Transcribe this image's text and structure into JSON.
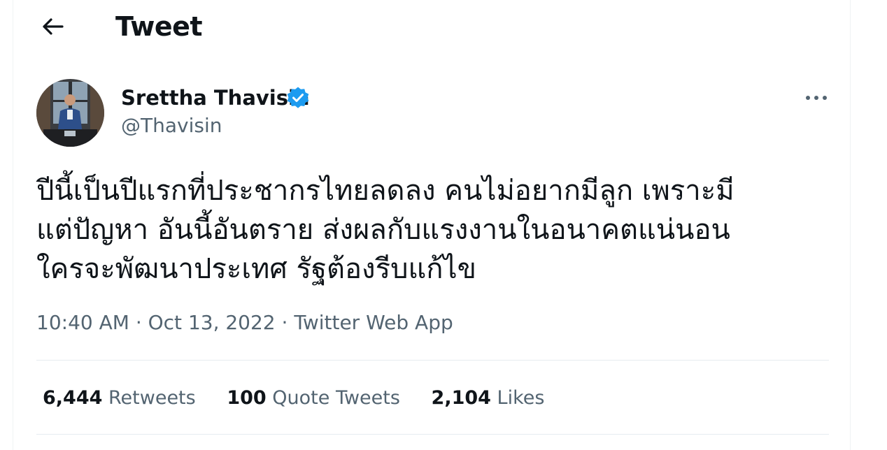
{
  "header": {
    "title": "Tweet"
  },
  "author": {
    "display_name": "Srettha Thavisin",
    "handle": "@Thavisin",
    "verified": true
  },
  "tweet": {
    "text": "ปีนี้เป็นปีแรกที่ประชากรไทยลดลง คนไม่อยากมีลูก เพราะมี\nแต่ปัญหา อันนี้อันตราย ส่งผลกับแรงงานในอนาคตแน่นอน\nใครจะพัฒนาประเทศ รัฐต้องรีบแก้ไข",
    "time": "10:40 AM",
    "separator": "·",
    "date": "Oct 13, 2022",
    "source": "Twitter Web App"
  },
  "stats": {
    "retweets_count": "6,444",
    "retweets_label": "Retweets",
    "quotes_count": "100",
    "quotes_label": "Quote Tweets",
    "likes_count": "2,104",
    "likes_label": "Likes"
  },
  "colors": {
    "text_primary": "#0f1419",
    "text_secondary": "#536471",
    "verified_blue": "#1d9bf0",
    "divider": "#e6ecf0"
  },
  "icons": {
    "back": "arrow-left-icon",
    "verified": "verified-badge-icon",
    "more": "more-horizontal-icon"
  }
}
